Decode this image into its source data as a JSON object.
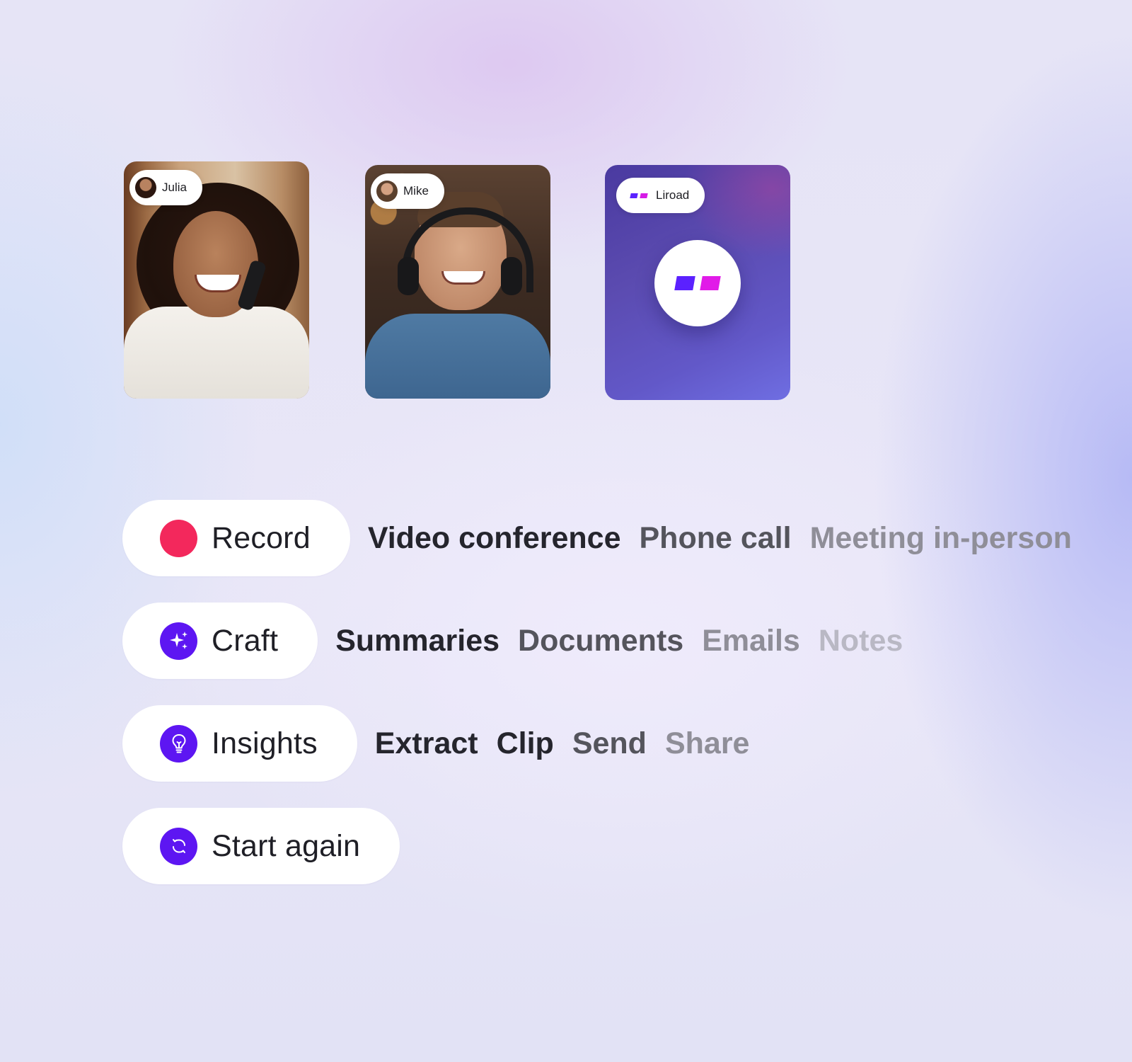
{
  "participants": [
    {
      "name": "Julia"
    },
    {
      "name": "Mike"
    },
    {
      "name": "Liroad"
    }
  ],
  "actions": [
    {
      "label": "Record",
      "icon": "record-dot-icon",
      "icon_color": "#f3285c",
      "options": [
        "Video conference",
        "Phone call",
        "Meeting in-person"
      ]
    },
    {
      "label": "Craft",
      "icon": "sparkles-icon",
      "icon_color": "#5d16f2",
      "options": [
        "Summaries",
        "Documents",
        "Emails",
        "Notes"
      ]
    },
    {
      "label": "Insights",
      "icon": "lightbulb-icon",
      "icon_color": "#5d16f2",
      "options": [
        "Extract",
        "Clip",
        "Send",
        "Share"
      ]
    },
    {
      "label": "Start again",
      "icon": "refresh-icon",
      "icon_color": "#5d16f2",
      "options": []
    }
  ],
  "brand_colors": {
    "primary": "#5b21ff",
    "secondary": "#e11be8"
  }
}
